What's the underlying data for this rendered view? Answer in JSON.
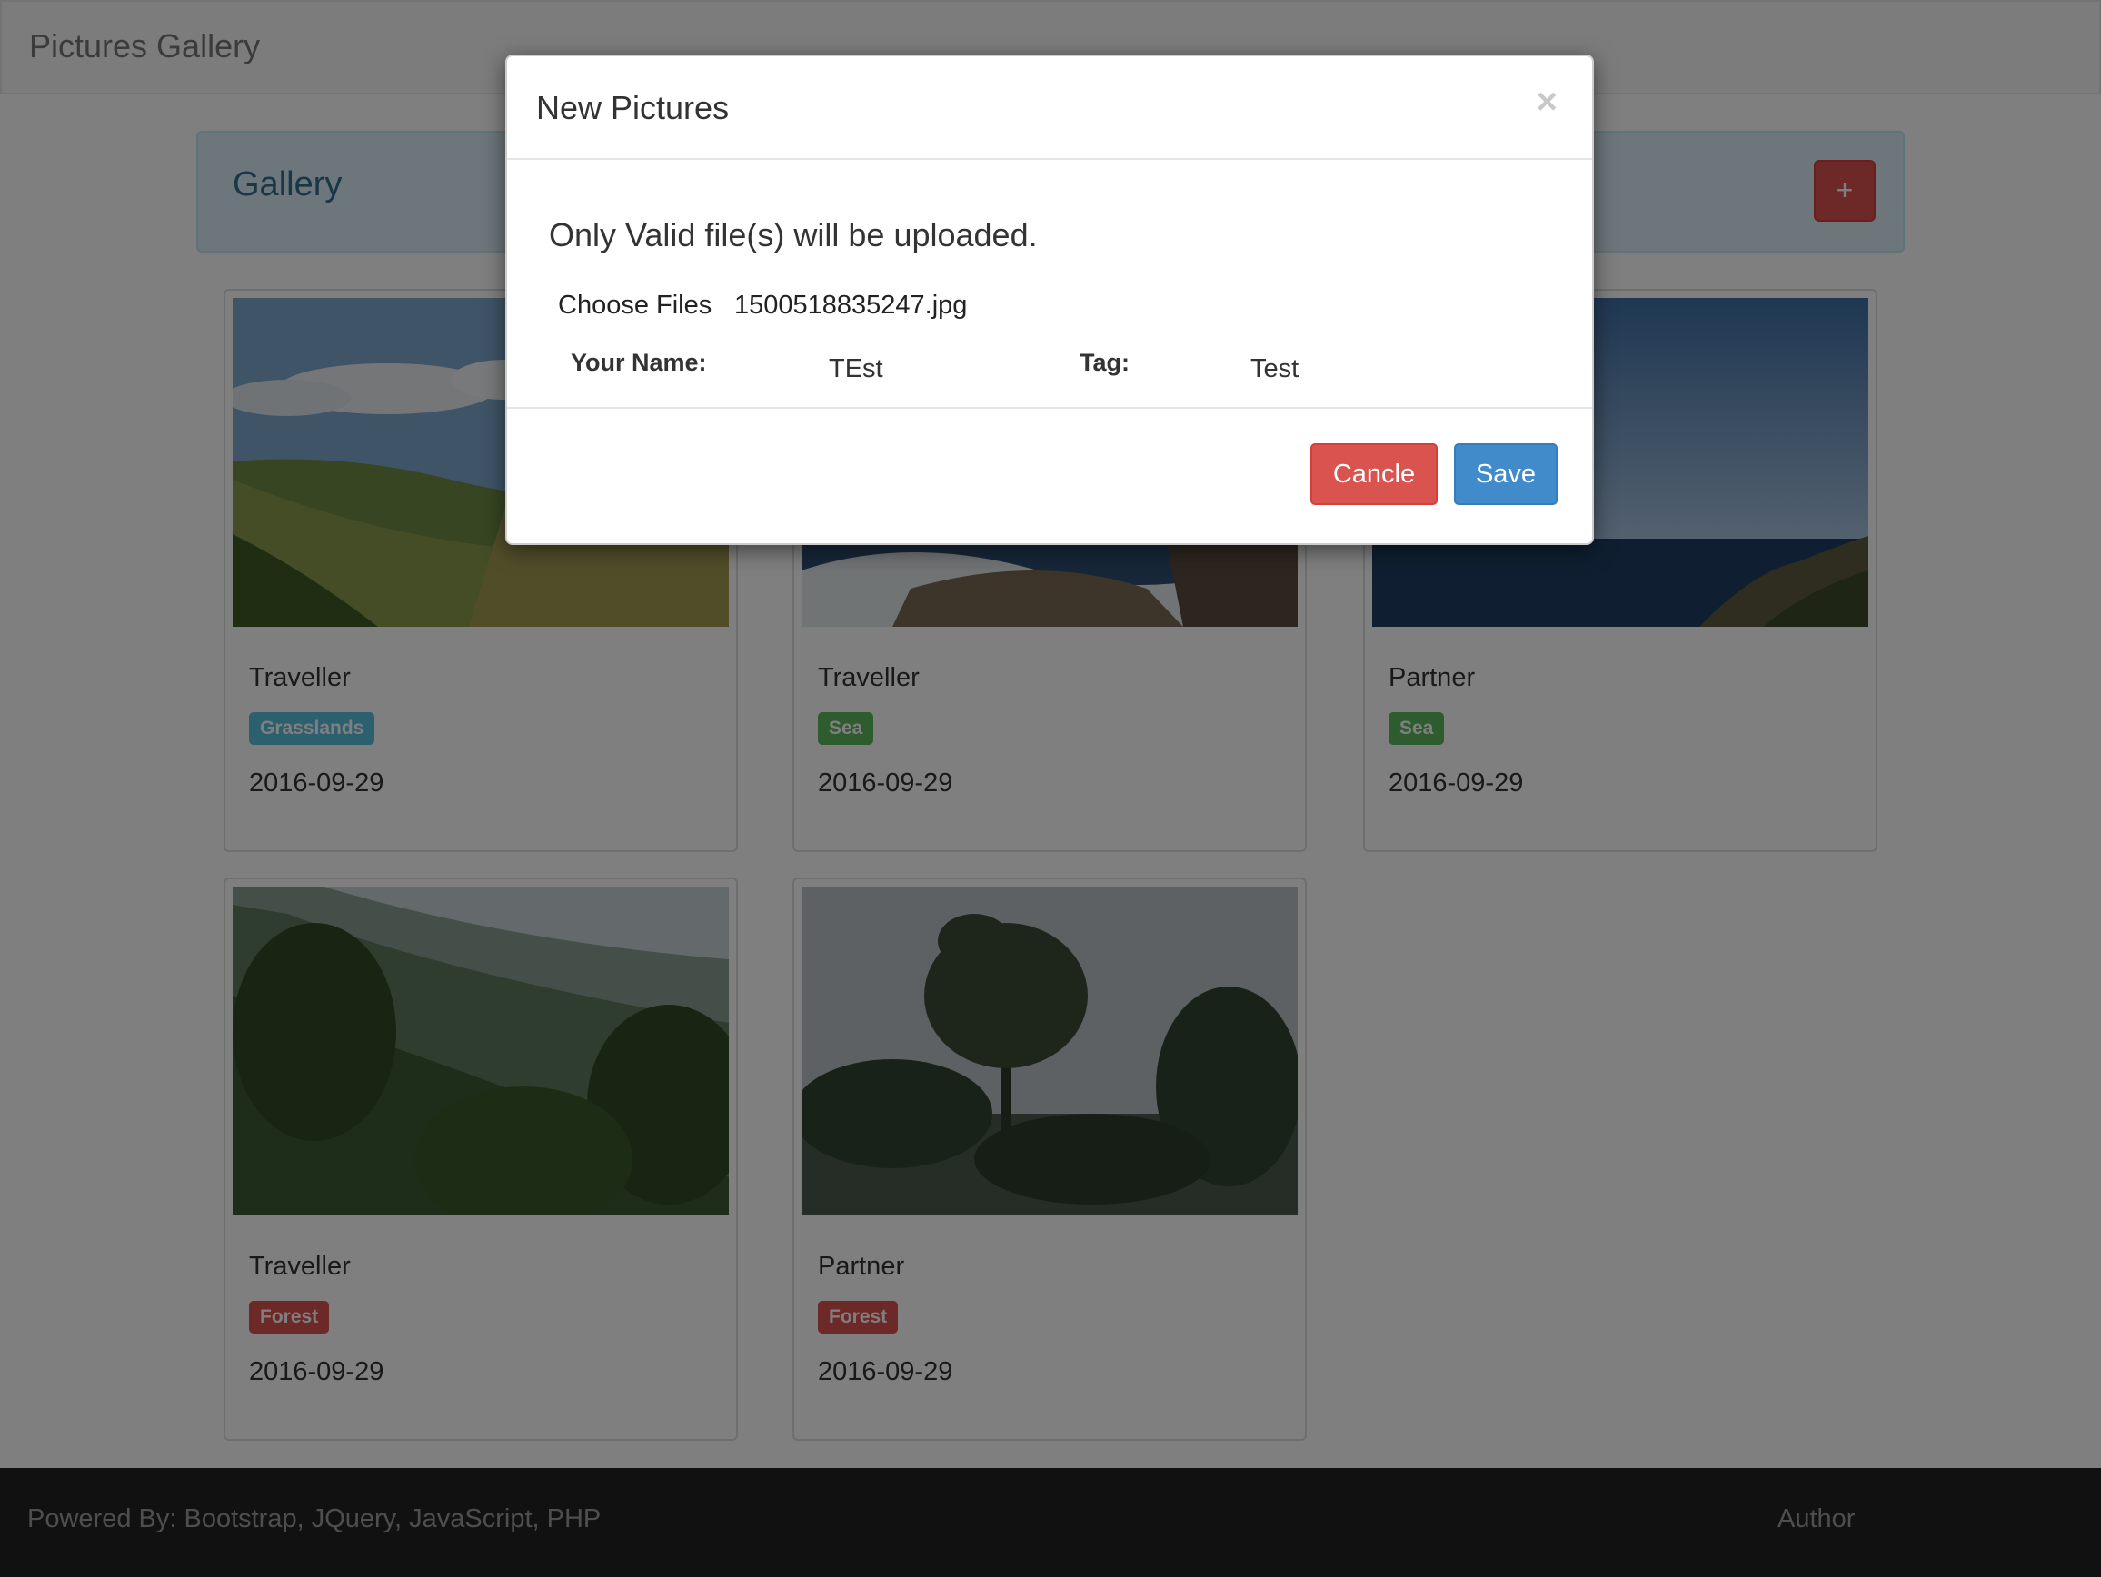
{
  "navbar": {
    "brand": "Pictures Gallery"
  },
  "gallery": {
    "title": "Gallery",
    "add_label": "+"
  },
  "cards": [
    {
      "name": "Traveller",
      "tag": "Grasslands",
      "tag_color": "#5bc0de",
      "date": "2016-09-29",
      "image": "grassland-landscape"
    },
    {
      "name": "Traveller",
      "tag": "Sea",
      "tag_color": "#5cb85c",
      "date": "2016-09-29",
      "image": "rocky-coast"
    },
    {
      "name": "Partner",
      "tag": "Sea",
      "tag_color": "#5cb85c",
      "date": "2016-09-29",
      "image": "ocean-cliffs"
    },
    {
      "name": "Traveller",
      "tag": "Forest",
      "tag_color": "#d9534f",
      "date": "2016-09-29",
      "image": "forest-valley"
    },
    {
      "name": "Partner",
      "tag": "Forest",
      "tag_color": "#d9534f",
      "date": "2016-09-29",
      "image": "tall-trees"
    }
  ],
  "footer": {
    "powered": "Powered By: Bootstrap, JQuery, JavaScript, PHP",
    "author": "Author"
  },
  "modal": {
    "title": "New Pictures",
    "close": "×",
    "notice": "Only Valid file(s) will be uploaded.",
    "choose_files": "Choose Files",
    "file_name": "1500518835247.jpg",
    "name_label": "Your Name:",
    "name_value": "TEst",
    "tag_label": "Tag:",
    "tag_value": "Test",
    "cancel": "Cancle",
    "save": "Save"
  }
}
